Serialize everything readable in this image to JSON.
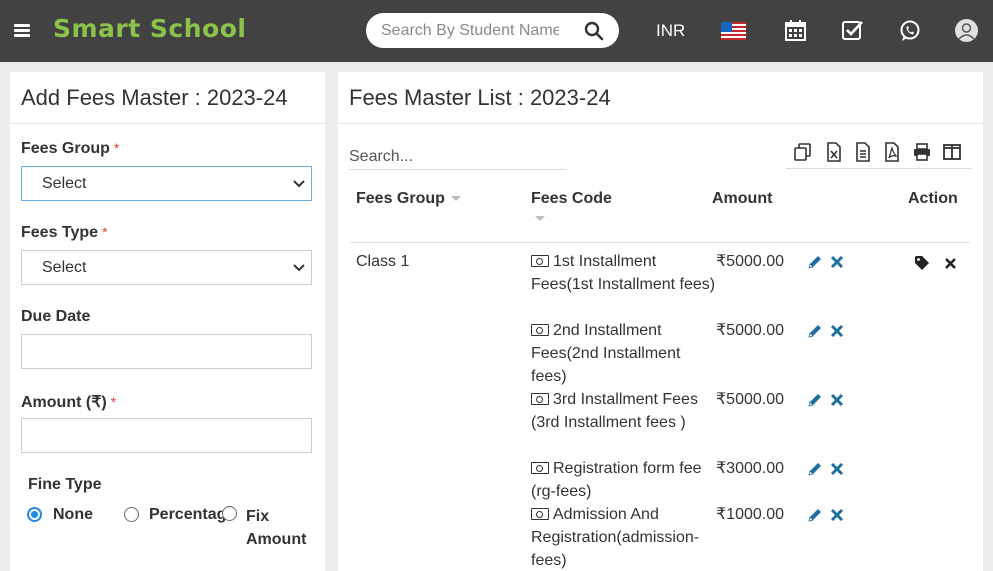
{
  "app": {
    "brand": "Smart School"
  },
  "topbar": {
    "search_placeholder": "Search By Student Name",
    "currency": "INR",
    "icons": [
      "menu-icon",
      "search-icon",
      "us-flag-icon",
      "calendar-icon",
      "tasks-check-icon",
      "whatsapp-icon",
      "user-avatar-icon"
    ]
  },
  "add_form": {
    "title": "Add Fees Master : 2023-24",
    "fees_group": {
      "label": "Fees Group",
      "required": "*",
      "value": "Select"
    },
    "fees_type": {
      "label": "Fees Type",
      "required": "*",
      "value": "Select"
    },
    "due_date": {
      "label": "Due Date",
      "value": ""
    },
    "amount": {
      "label": "Amount (₹)",
      "required": "*",
      "value": ""
    },
    "fine_type": {
      "label": "Fine Type",
      "options": [
        {
          "label": "None",
          "checked": true
        },
        {
          "label": "Percentage",
          "checked": false
        },
        {
          "label": "Fix Amount",
          "checked": false
        }
      ]
    }
  },
  "list": {
    "title": "Fees Master List : 2023-24",
    "search_placeholder": "Search...",
    "toolbar_icons": [
      "copy-icon",
      "excel-icon",
      "csv-icon",
      "pdf-icon",
      "print-icon",
      "columns-icon"
    ],
    "columns": {
      "group": "Fees Group",
      "code": "Fees Code",
      "amount": "Amount",
      "action": "Action"
    },
    "rows": [
      {
        "group": "Class 1",
        "fees": [
          {
            "code": "1st Installment Fees(1st Installment fees)",
            "amount": "₹5000.00"
          },
          {
            "code": "2nd Installment Fees(2nd Installment fees)",
            "amount": "₹5000.00"
          },
          {
            "code": "3rd Installment Fees (3rd Installment fees )",
            "amount": "₹5000.00"
          },
          {
            "code": "Registration form fee (rg-fees)",
            "amount": "₹3000.00"
          },
          {
            "code": "Admission And Registration(admission-fees)",
            "amount": "₹1000.00"
          }
        ]
      }
    ]
  },
  "colors": {
    "topbar": "#424242",
    "brand": "#8bc34a",
    "action": "#1f6f9f",
    "required": "#e53935",
    "radio": "#1e88e5"
  }
}
